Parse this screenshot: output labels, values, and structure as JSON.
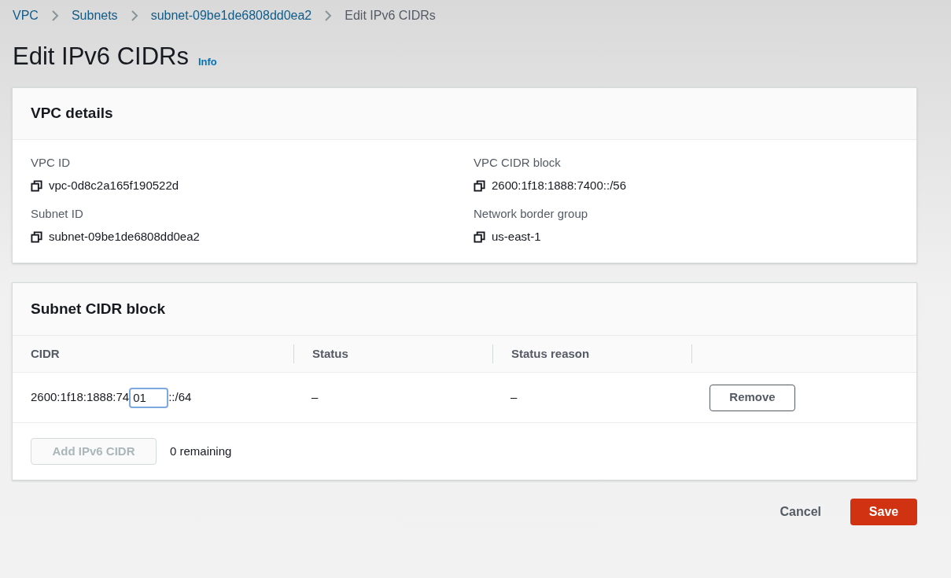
{
  "breadcrumbs": [
    {
      "label": "VPC",
      "link": true
    },
    {
      "label": "Subnets",
      "link": true
    },
    {
      "label": "subnet-09be1de6808dd0ea2",
      "link": true
    },
    {
      "label": "Edit IPv6 CIDRs",
      "link": false
    }
  ],
  "page_title": "Edit IPv6 CIDRs",
  "info_link": "Info",
  "vpc_details": {
    "title": "VPC details",
    "fields": [
      {
        "label": "VPC ID",
        "value": "vpc-0d8c2a165f190522d"
      },
      {
        "label": "VPC CIDR block",
        "value": "2600:1f18:1888:7400::/56"
      },
      {
        "label": "Subnet ID",
        "value": "subnet-09be1de6808dd0ea2"
      },
      {
        "label": "Network border group",
        "value": "us-east-1"
      }
    ]
  },
  "subnet_cidr": {
    "title": "Subnet CIDR block",
    "columns": [
      "CIDR",
      "Status",
      "Status reason"
    ],
    "rows": [
      {
        "prefix": "2600:1f18:1888:74",
        "input_value": "01",
        "focused": true,
        "suffix": "::/64",
        "status": "–",
        "status_reason": "–",
        "action": "Remove"
      }
    ],
    "add_button": {
      "label": "Add IPv6 CIDR",
      "disabled": true
    },
    "remaining": "0 remaining"
  },
  "footer": {
    "cancel": "Cancel",
    "save": "Save"
  }
}
